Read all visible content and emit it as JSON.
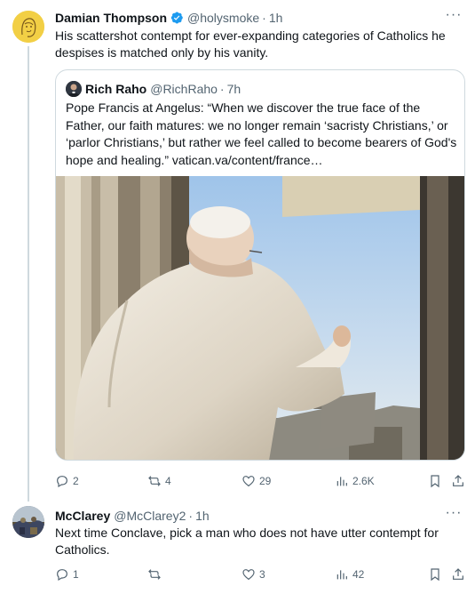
{
  "tweet1": {
    "author_name": "Damian Thompson",
    "author_handle": "@holysmoke",
    "dot": "·",
    "time": "1h",
    "more": "···",
    "text": "His scattershot contempt for ever-expanding categories of Catholics he despises is matched only by his vanity.",
    "quote": {
      "author_name": "Rich Raho",
      "author_handle": "@RichRaho",
      "dot": "·",
      "time": "7h",
      "text": "Pope Francis at Angelus: “When we discover the true face of the Father, our faith matures: we no longer remain ‘sacristy Christians,’ or ‘parlor Christians,’ but rather we feel called to become bearers of God's hope and healing.” vatican.va/content/france…"
    },
    "actions": {
      "replies": "2",
      "reposts": "4",
      "likes": "29",
      "views": "2.6K"
    }
  },
  "tweet2": {
    "author_name": "McClarey",
    "author_handle": "@McClarey2",
    "dot": "·",
    "time": "1h",
    "more": "···",
    "text": "Next time Conclave, pick a man who does not have utter contempt for Catholics.",
    "actions": {
      "replies": "1",
      "reposts": "",
      "likes": "3",
      "views": "42"
    }
  },
  "colors": {
    "text": "#0f1419",
    "secondary": "#536471",
    "border": "#cfd9de",
    "verified": "#1d9bf0"
  },
  "icons": [
    "verified-badge-icon",
    "reply-icon",
    "repost-icon",
    "like-icon",
    "views-icon",
    "bookmark-icon",
    "share-icon",
    "more-icon"
  ]
}
